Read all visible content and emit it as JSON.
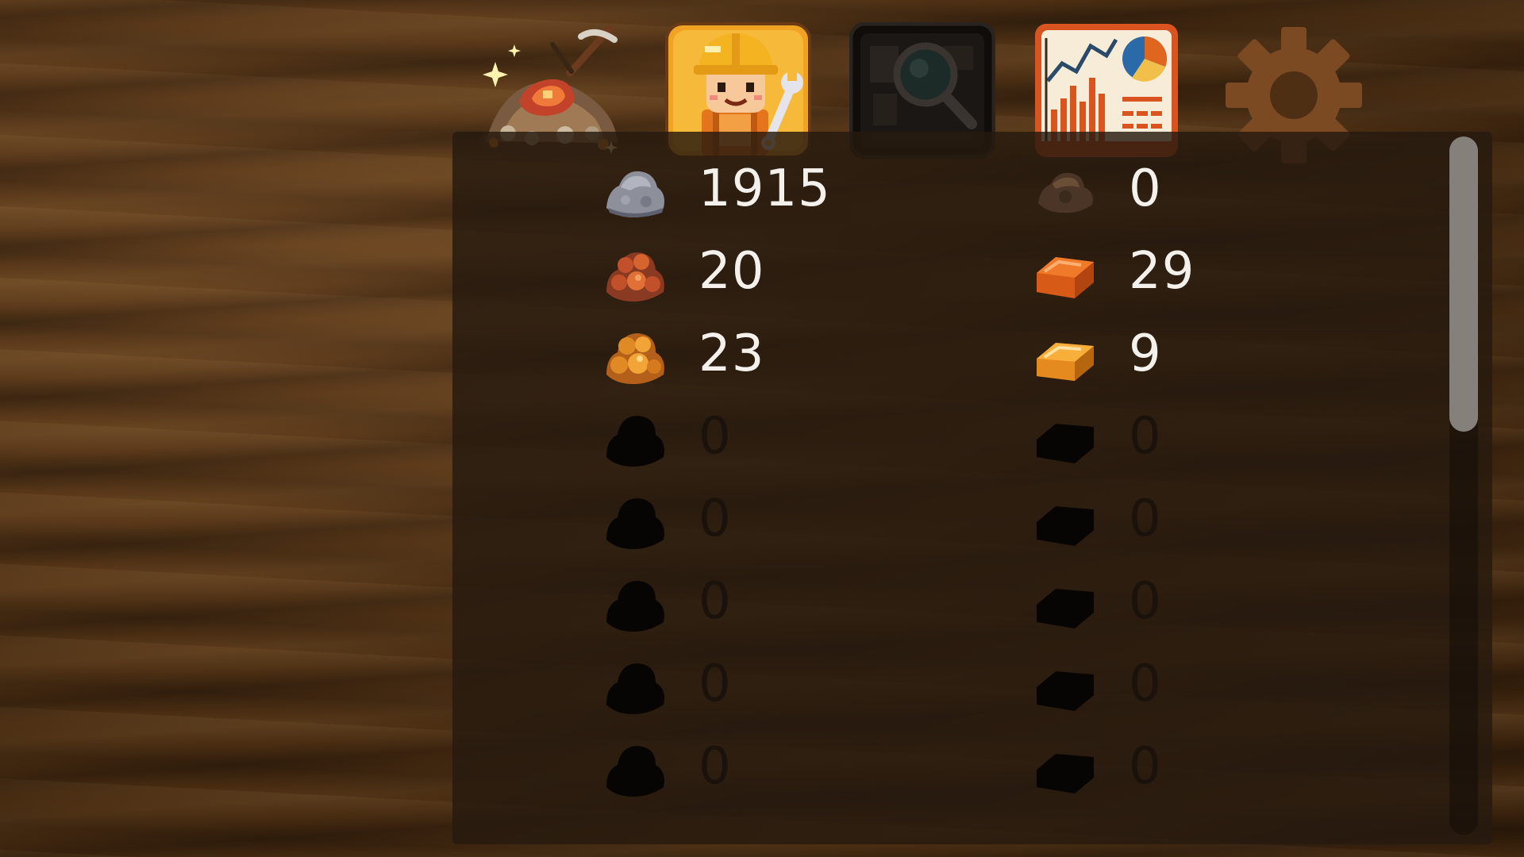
{
  "toolbar": {
    "buttons": [
      {
        "id": "mine",
        "icon": "ore-pile-pickaxe-icon"
      },
      {
        "id": "workers",
        "icon": "worker-with-wrench-icon"
      },
      {
        "id": "research",
        "icon": "magnifying-glass-icon"
      },
      {
        "id": "stats",
        "icon": "chart-report-icon"
      },
      {
        "id": "settings",
        "icon": "gear-icon"
      }
    ]
  },
  "inventory": {
    "ores": [
      {
        "icon": "stone-ore-icon",
        "count": "1915",
        "locked": false,
        "color": "#8d8f9b"
      },
      {
        "icon": "copper-ore-icon",
        "count": "20",
        "locked": false,
        "color": "#c2502a"
      },
      {
        "icon": "gold-ore-icon",
        "count": "23",
        "locked": false,
        "color": "#e08a25"
      },
      {
        "icon": "locked-ore-icon",
        "count": "0",
        "locked": true
      },
      {
        "icon": "locked-ore-icon",
        "count": "0",
        "locked": true
      },
      {
        "icon": "locked-ore-icon",
        "count": "0",
        "locked": true
      },
      {
        "icon": "locked-ore-icon",
        "count": "0",
        "locked": true
      },
      {
        "icon": "locked-ore-icon",
        "count": "0",
        "locked": true
      }
    ],
    "bars": [
      {
        "icon": "stone-brick-icon",
        "count": "0",
        "locked": false,
        "color": "#5a4230"
      },
      {
        "icon": "copper-bar-icon",
        "count": "29",
        "locked": false,
        "color": "#e0621c"
      },
      {
        "icon": "gold-bar-icon",
        "count": "9",
        "locked": false,
        "color": "#f09a2a"
      },
      {
        "icon": "locked-bar-icon",
        "count": "0",
        "locked": true
      },
      {
        "icon": "locked-bar-icon",
        "count": "0",
        "locked": true
      },
      {
        "icon": "locked-bar-icon",
        "count": "0",
        "locked": true
      },
      {
        "icon": "locked-bar-icon",
        "count": "0",
        "locked": true
      },
      {
        "icon": "locked-bar-icon",
        "count": "0",
        "locked": true
      }
    ]
  },
  "scrollbar": {
    "position": 0.0
  }
}
